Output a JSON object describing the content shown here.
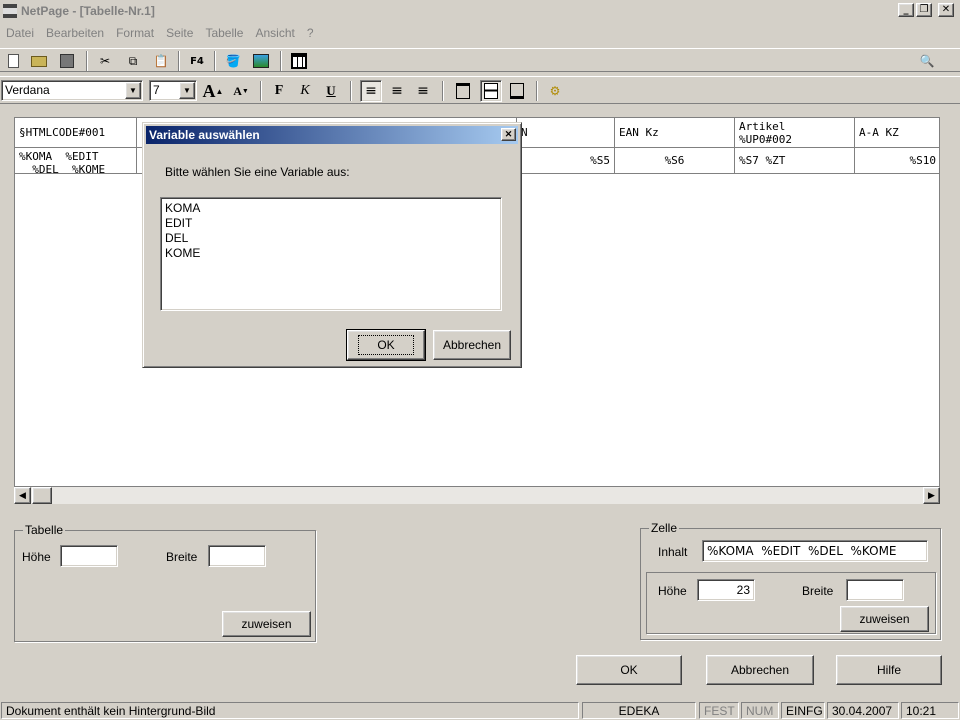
{
  "window": {
    "title": "NetPage - [Tabelle-Nr.1]"
  },
  "menu": [
    "Datei",
    "Bearbeiten",
    "Format",
    "Seite",
    "Tabelle",
    "Ansicht",
    "?"
  ],
  "toolbar": {
    "f4_label": "F4"
  },
  "format": {
    "font": "Verdana",
    "size": "7",
    "bold": "F",
    "italic": "K",
    "underline": "U"
  },
  "grid": {
    "headers": [
      "§HTMLCODE#001",
      "",
      "N",
      "EAN Kz",
      "Artikel\n%UP0#002",
      "A-A KZ"
    ],
    "row1": [
      "%KOMA  %EDIT\n  %DEL  %KOME",
      "",
      "%S5",
      "%S6",
      "%S7 %ZT",
      "%S10"
    ]
  },
  "tabelle": {
    "legend": "Tabelle",
    "hoehe_label": "Höhe",
    "breite_label": "Breite",
    "hoehe_value": "",
    "breite_value": "",
    "assign_label": "zuweisen"
  },
  "zelle": {
    "legend": "Zelle",
    "inhalt_label": "Inhalt",
    "inhalt_value": "%KOMA  %EDIT  %DEL  %KOME",
    "hoehe_label": "Höhe",
    "hoehe_value": "23",
    "breite_label": "Breite",
    "breite_value": "",
    "assign_label": "zuweisen"
  },
  "buttons": {
    "ok": "OK",
    "cancel": "Abbrechen",
    "help": "Hilfe"
  },
  "dialog": {
    "title": "Variable auswählen",
    "prompt": "Bitte wählen Sie eine Variable aus:",
    "items": [
      "KOMA",
      "EDIT",
      "DEL",
      "KOME"
    ],
    "ok": "OK",
    "cancel": "Abbrechen"
  },
  "status": {
    "message": "Dokument enthält kein Hintergrund-Bild",
    "company": "EDEKA",
    "fest": "FEST",
    "num": "NUM",
    "einfg": "EINFG",
    "date": "30.04.2007",
    "time": "10:21"
  }
}
